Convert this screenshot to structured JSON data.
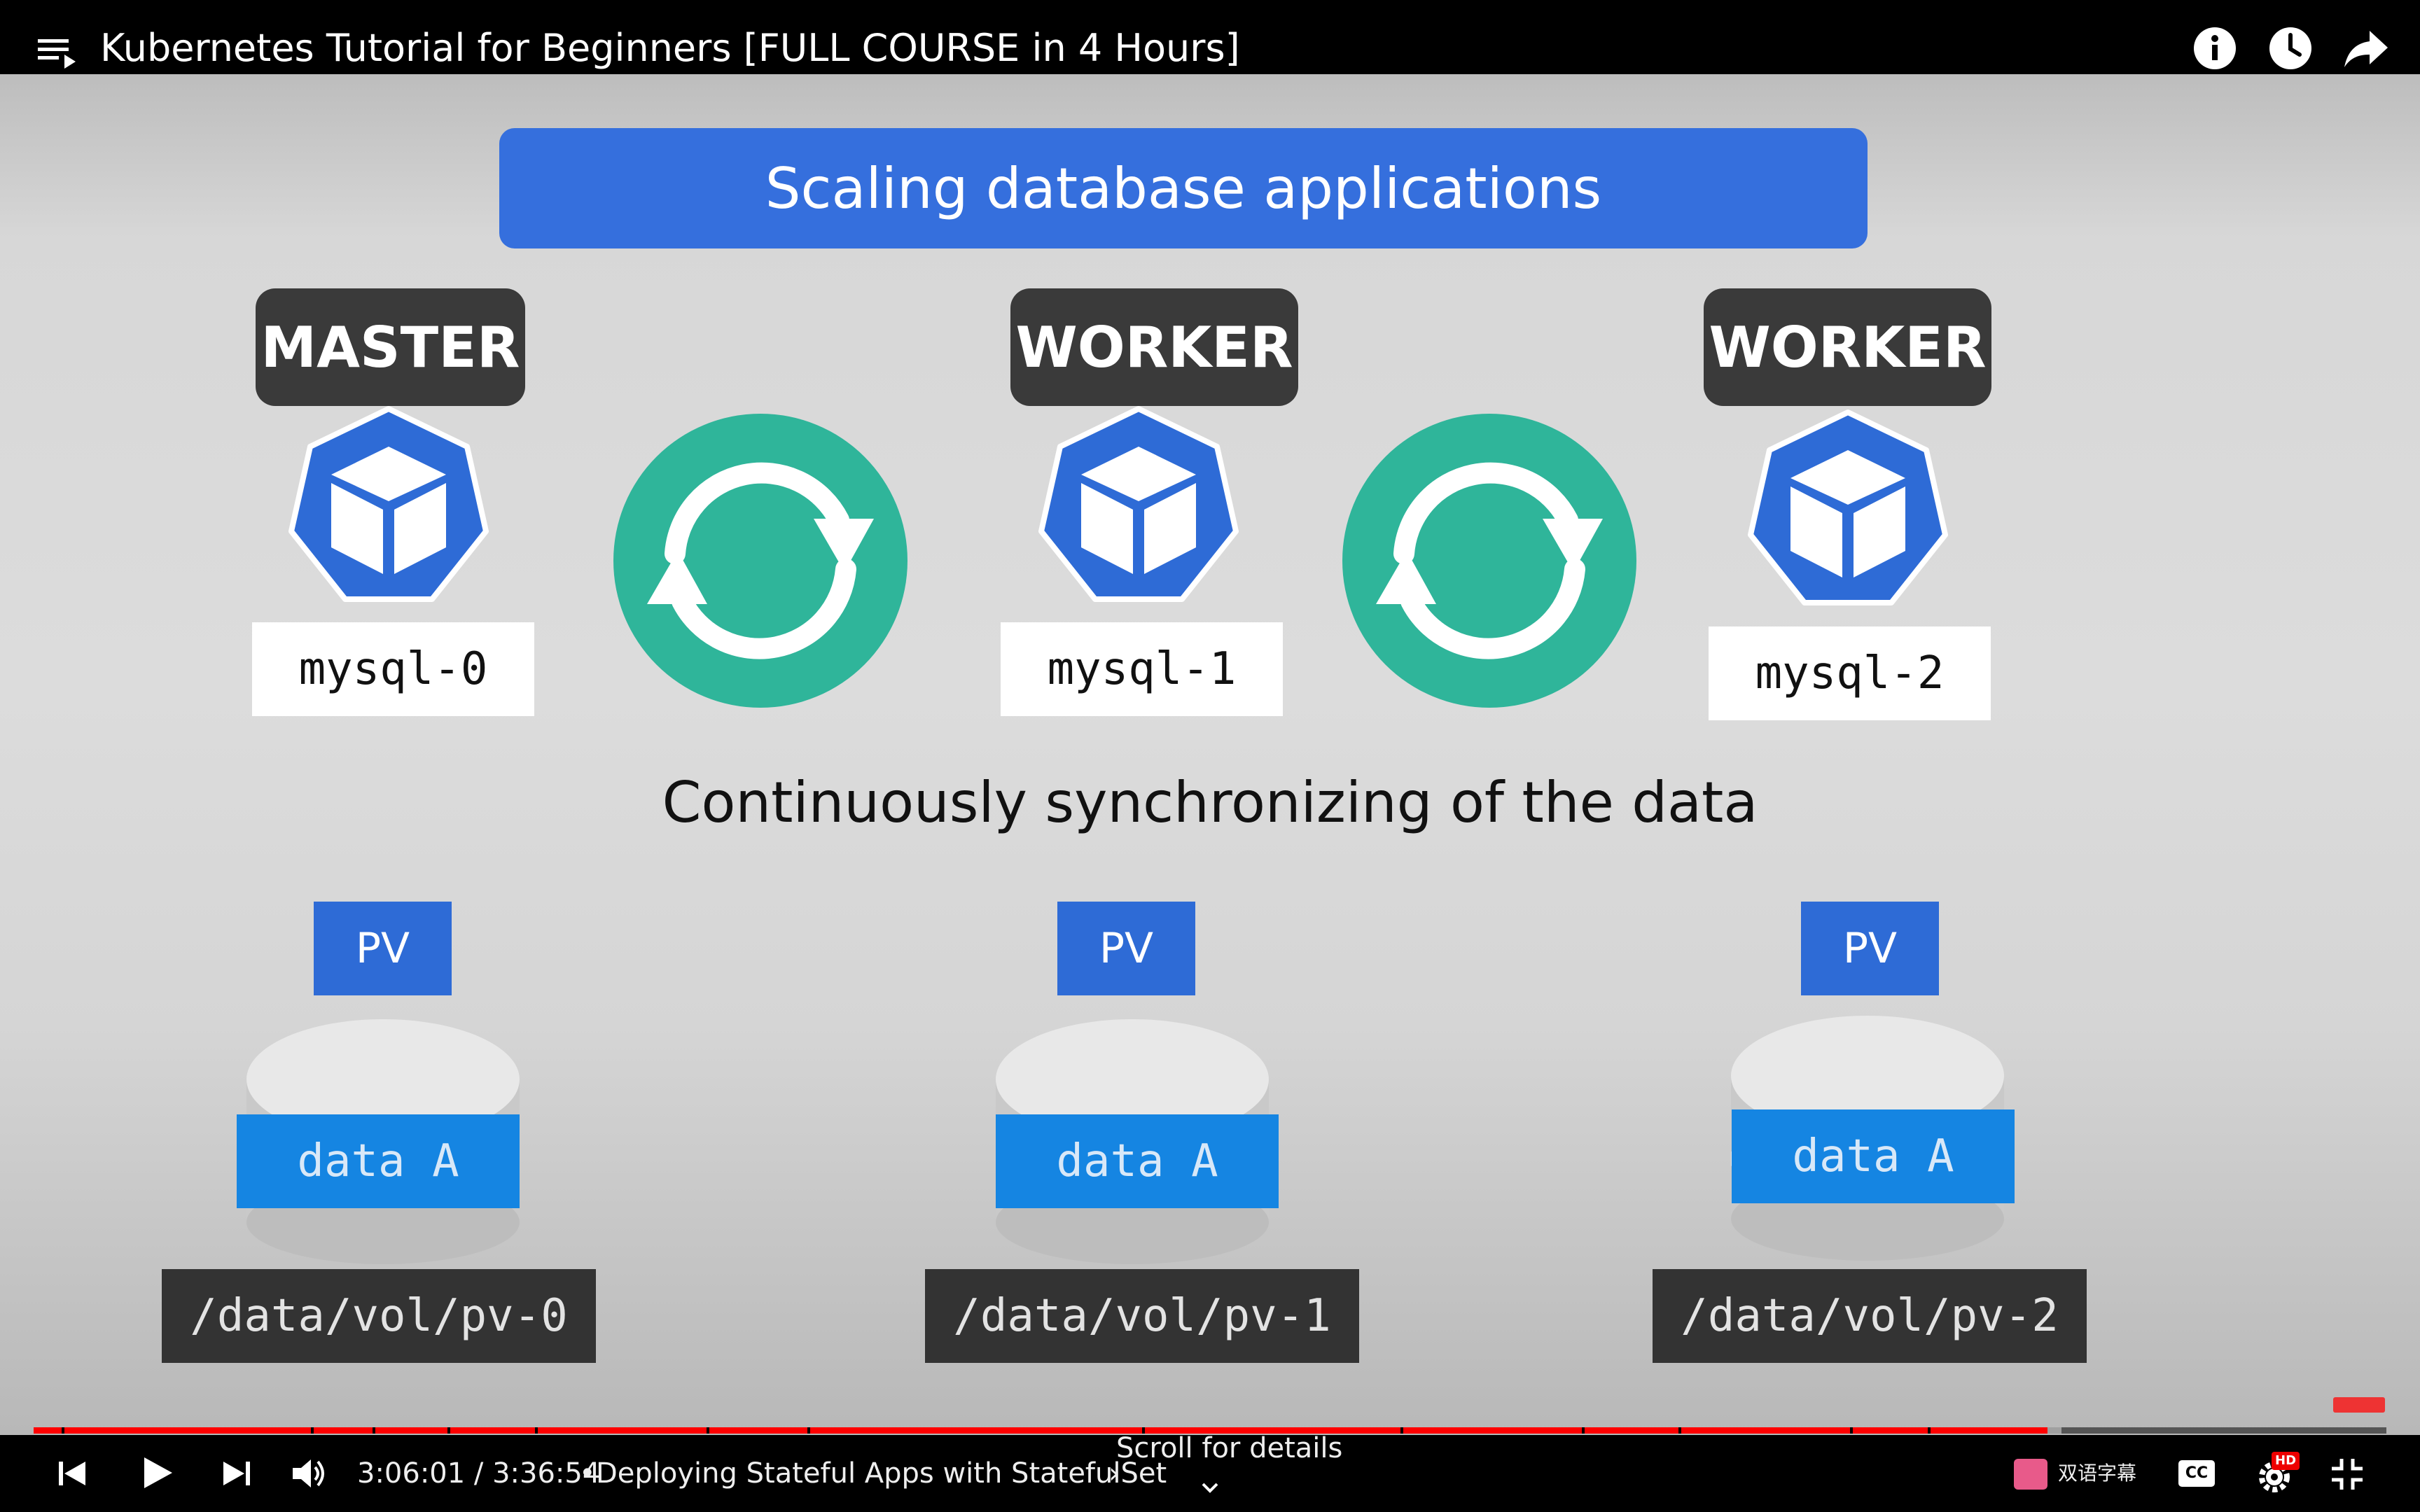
{
  "window": {
    "title": "Kubernetes Tutorial for Beginners [FULL COURSE in 4 Hours]"
  },
  "top_icons": [
    "playlist-icon",
    "info-icon",
    "watch-later-icon",
    "share-icon"
  ],
  "slide": {
    "banner": "Scaling database applications",
    "nodes": [
      {
        "role": "MASTER",
        "pod": "mysql-0"
      },
      {
        "role": "WORKER",
        "pod": "mysql-1"
      },
      {
        "role": "WORKER",
        "pod": "mysql-2"
      }
    ],
    "caption": "Continuously synchronizing of the data",
    "volumes": [
      {
        "pv": "PV",
        "data": "data A",
        "path": "/data/vol/pv-0"
      },
      {
        "pv": "PV",
        "data": "data A",
        "path": "/data/vol/pv-1"
      },
      {
        "pv": "PV",
        "data": "data A",
        "path": "/data/vol/pv-2"
      }
    ],
    "colors": {
      "banner": "#356fdd",
      "sync": "#2fb59a",
      "k8s": "#2e6bd6",
      "data": "#1585e2"
    }
  },
  "player": {
    "time": "3:06:01 / 3:36:54",
    "separator": "•",
    "chapter": "Deploying Stateful Apps with StatefulSet",
    "chapter_chevron": "›",
    "scroll_hint": "Scroll for details",
    "subtitle_plugin": "双语字幕",
    "cc": "CC",
    "hd_badge": "HD",
    "progress_fraction": 0.856,
    "buffered_fraction": 0.862,
    "colors": {
      "played": "#ff0000",
      "buffered": "#a0a0a0"
    }
  }
}
